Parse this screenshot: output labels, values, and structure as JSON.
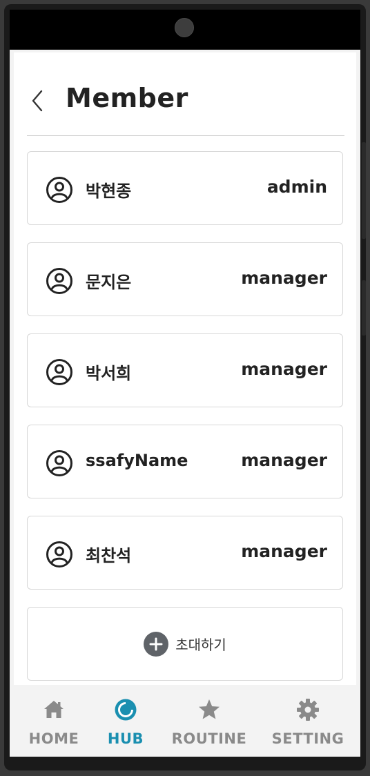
{
  "header": {
    "title": "Member"
  },
  "members": [
    {
      "name": "박현종",
      "role": "admin"
    },
    {
      "name": "문지은",
      "role": "manager"
    },
    {
      "name": "박서희",
      "role": "manager"
    },
    {
      "name": "ssafyName",
      "role": "manager"
    },
    {
      "name": "최찬석",
      "role": "manager"
    }
  ],
  "invite": {
    "label": "초대하기",
    "icon": "plus-circle-icon"
  },
  "nav": {
    "items": [
      {
        "label": "HOME",
        "icon": "home-icon"
      },
      {
        "label": "HUB",
        "icon": "hub-icon"
      },
      {
        "label": "ROUTINE",
        "icon": "star-icon"
      },
      {
        "label": "SETTING",
        "icon": "gear-icon"
      }
    ],
    "active_color": "#1a8fb0",
    "inactive_color": "#8a8a8a"
  }
}
